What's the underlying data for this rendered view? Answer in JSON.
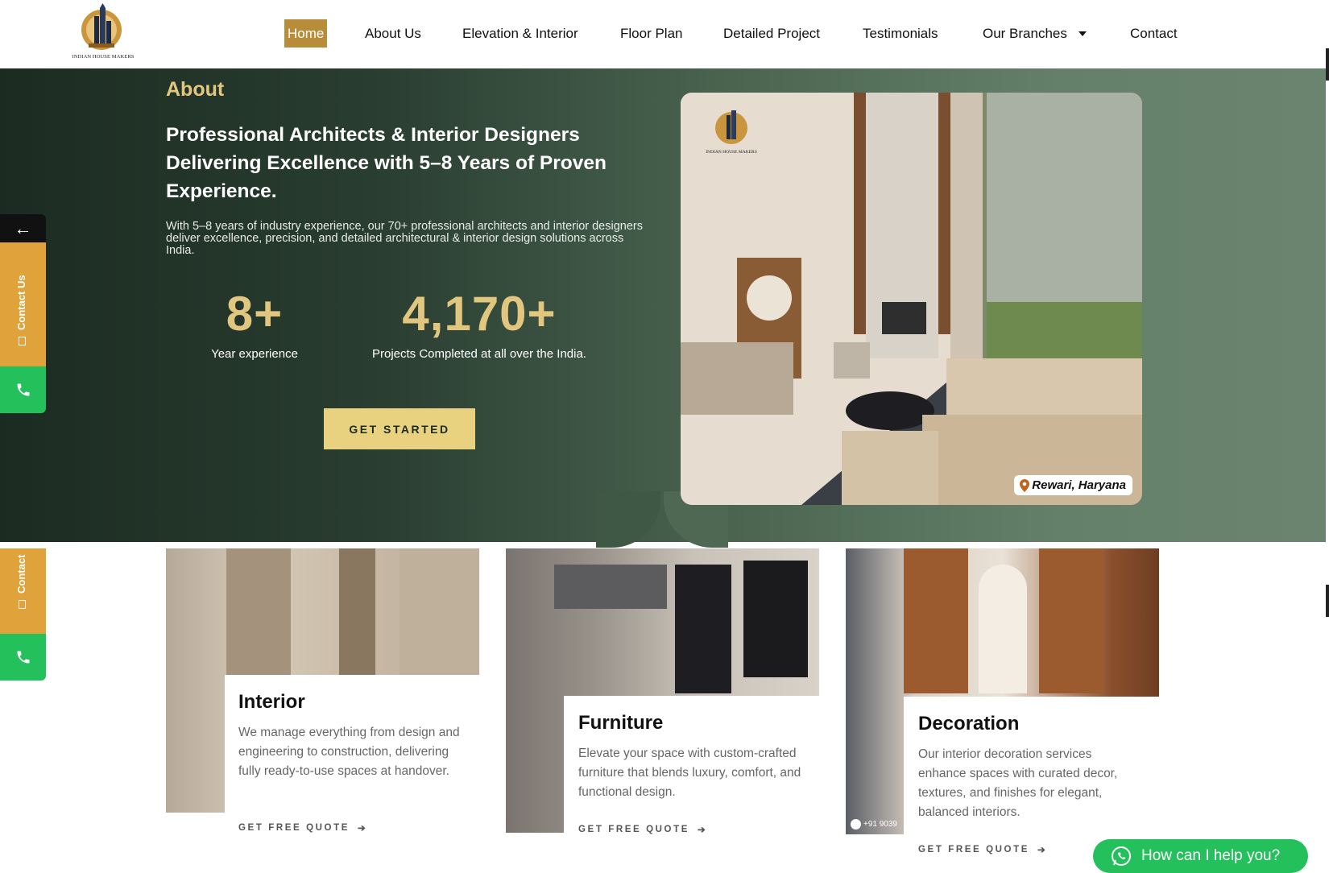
{
  "brand": {
    "name": "INDIAN HOUSE MAKERS"
  },
  "nav": {
    "items": [
      {
        "label": "Home",
        "active": true
      },
      {
        "label": "About Us"
      },
      {
        "label": "Elevation & Interior"
      },
      {
        "label": "Floor Plan"
      },
      {
        "label": "Detailed Project"
      },
      {
        "label": "Testimonials"
      },
      {
        "label": "Our Branches"
      },
      {
        "label": "Contact"
      }
    ]
  },
  "hero": {
    "section_label": "About",
    "title": "Professional Architects & Interior Designers Delivering Excellence with 5–8 Years of Proven Experience.",
    "description": "With 5–8 years of industry experience, our 70+ professional architects and interior designers deliver excellence, precision, and detailed architectural & interior design solutions across India.",
    "stats": [
      {
        "value": "8+",
        "label": "Year experience"
      },
      {
        "value": "4,170+",
        "label": "Projects Completed at all over the India."
      }
    ],
    "cta_label": "GET STARTED",
    "image_location": "Rewari, Haryana"
  },
  "side_widget": {
    "back_arrow": "←",
    "contact_label": "Contact Us",
    "contact_label_short": "Contact",
    "phone_icon": "phone-icon"
  },
  "cards": [
    {
      "title": "Interior",
      "text": "We manage everything from design and engineering to construction, delivering fully ready-to-use spaces at handover.",
      "link": "GET FREE QUOTE"
    },
    {
      "title": "Furniture",
      "text": "Elevate your space with custom-crafted furniture that blends luxury, comfort, and functional design.",
      "link": "GET FREE QUOTE"
    },
    {
      "title": "Decoration",
      "text": "Our interior decoration services enhance spaces with curated decor, textures, and finishes for elegant, balanced interiors.",
      "link": "GET FREE QUOTE"
    }
  ],
  "whatsapp": {
    "label": "How can I help you?",
    "icon": "whatsapp-icon"
  },
  "decoration_phone_snippet": "+91 9039",
  "colors": {
    "accent_gold": "#b78d3a",
    "stat_gold": "#e0c67f",
    "cta_bg": "#e8d27f",
    "hero_dark": "#1c2b22",
    "hero_light": "#6b8470",
    "contact_orange": "#e0a33c",
    "phone_green": "#24c05c"
  }
}
